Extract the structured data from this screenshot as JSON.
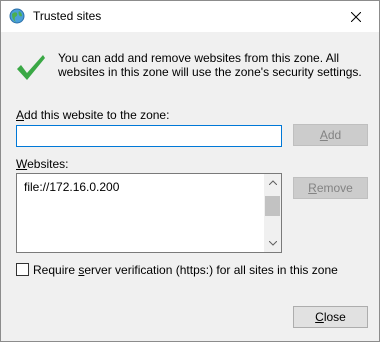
{
  "window": {
    "title": "Trusted sites",
    "close_glyph": "✕"
  },
  "info": {
    "icon": "checkmark-icon",
    "text": "You can add and remove websites from this zone. All websites in this zone will use the zone's security settings."
  },
  "add": {
    "label_prefix": "",
    "label_accel": "A",
    "label_rest": "dd this website to the zone:",
    "input_value": "",
    "button_accel": "A",
    "button_rest": "dd"
  },
  "websites": {
    "label_prefix": "",
    "label_accel": "W",
    "label_rest": "ebsites:",
    "items": [
      "file://172.16.0.200"
    ],
    "remove_accel": "R",
    "remove_rest": "emove"
  },
  "verification": {
    "checked": false,
    "label_prefix": "Require ",
    "label_accel": "s",
    "label_rest": "erver verification (https:) for all sites in this zone"
  },
  "close_button": {
    "accel": "C",
    "rest": "lose"
  },
  "colors": {
    "accent": "#0078d7",
    "check_green": "#3aa845"
  }
}
